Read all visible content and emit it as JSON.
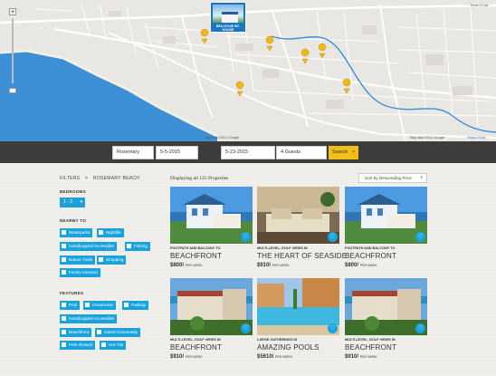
{
  "map": {
    "popup_title": "BELLEVUE BY-HOUSE",
    "credit": "Map data ©2014 Google",
    "credit_right": "Map data ©2014 Google",
    "terms": "Terms of Use",
    "credit_top": "Terms of Use",
    "zoom_in": "+",
    "pin_color": "#f1b81e",
    "water_color": "#3d8fd6"
  },
  "search": {
    "location": "Rosemary Beach",
    "checkin": "5-5-2015",
    "checkout": "5-23-2015",
    "guests": "4 Guests",
    "button": "Search",
    "button_arrow": ">"
  },
  "filters": {
    "breadcrumb_root": "FILTERS",
    "breadcrumb_sep": ">",
    "breadcrumb_current": "ROSEMARY BEACH",
    "bedrooms_label": "BEDROOMS",
    "bedrooms_value": "1 - 2",
    "nearby_label": "NEARBY TO",
    "nearby": [
      "Waterparks",
      "Nightlife",
      "Handicapped Accessible",
      "Fishing",
      "Nature Trails",
      "Shopping",
      "Family-oriented"
    ],
    "features_label": "FEATURES",
    "features": [
      "Pool",
      "Oceanview",
      "Parking",
      "Handicapped Accessible",
      "Beachfront",
      "Gated Community",
      "Pets Allowed",
      "Hot Tub"
    ]
  },
  "results": {
    "count_text": "Displaying all 125 Properties",
    "sort_label": "Sort by Descending Price",
    "cards": [
      {
        "sub": "FOOTPATH AND BALCONY TO",
        "title": "BEACHFRONT",
        "price": "$800/",
        "per": "PER WEEK",
        "img": "beach-house"
      },
      {
        "sub": "MULTI-LEVEL, GOLF VIEWS IN",
        "title": "THE HEART OF SEASIDE",
        "price": "$910/",
        "per": "PER WEEK",
        "img": "interior"
      },
      {
        "sub": "FOOTPATH AND BALCONY TO",
        "title": "BEACHFRONT",
        "price": "$800/",
        "per": "PER WEEK",
        "img": "beach-house"
      },
      {
        "sub": "MULTI-LEVEL, GOLF VIEWS IN",
        "title": "BEACHFRONT",
        "price": "$910/",
        "per": "PER WEEK",
        "img": "resort"
      },
      {
        "sub": "LARGE GATHERINGS IN",
        "title": "AMAZING POOLS",
        "price": "$5610/",
        "per": "PER WEEK",
        "img": "pool"
      },
      {
        "sub": "MULTI-LEVEL, GOLF VIEWS IN",
        "title": "BEACHFRONT",
        "price": "$910/",
        "per": "PER WEEK",
        "img": "resort"
      }
    ]
  },
  "colors": {
    "accent": "#19a3dd",
    "search_button": "#f2bf1a",
    "search_bar": "#3c3c3c"
  }
}
